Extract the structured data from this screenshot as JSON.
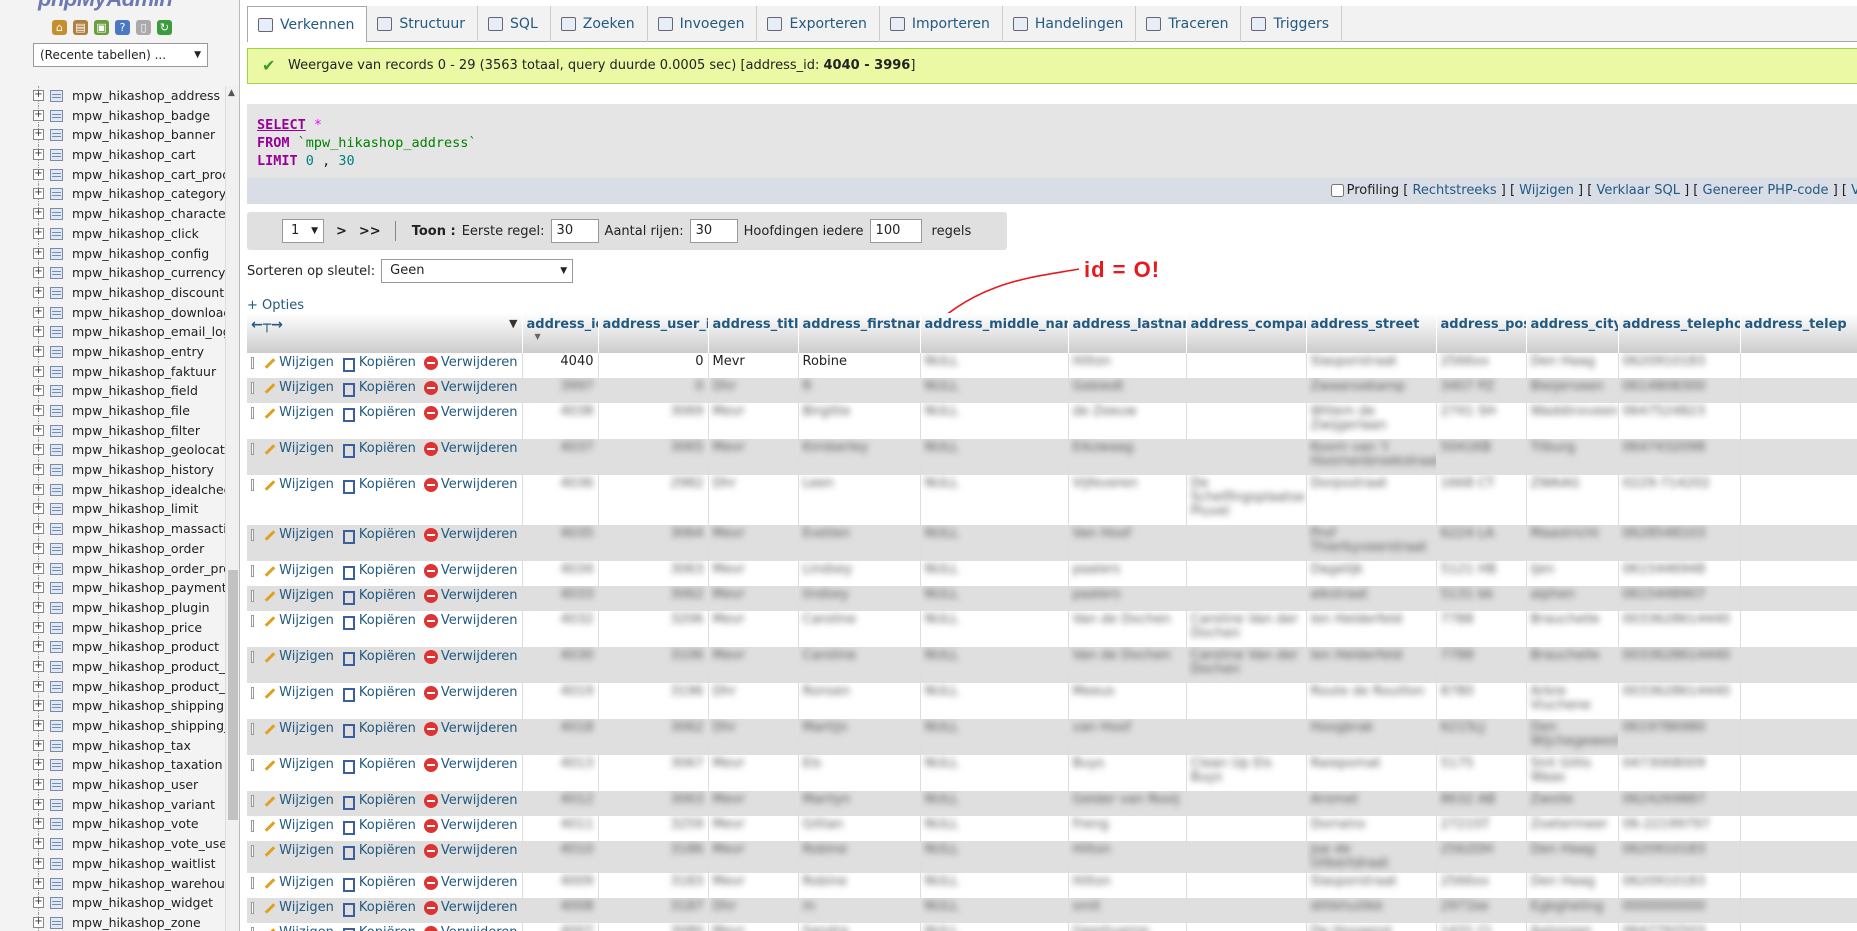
{
  "sidebar": {
    "logo": "phpMyAdmin",
    "recent_select": "(Recente tabellen) ...",
    "tables": [
      "mpw_hikashop_address",
      "mpw_hikashop_badge",
      "mpw_hikashop_banner",
      "mpw_hikashop_cart",
      "mpw_hikashop_cart_produ",
      "mpw_hikashop_category",
      "mpw_hikashop_characteri",
      "mpw_hikashop_click",
      "mpw_hikashop_config",
      "mpw_hikashop_currency",
      "mpw_hikashop_discount",
      "mpw_hikashop_download",
      "mpw_hikashop_email_log",
      "mpw_hikashop_entry",
      "mpw_hikashop_faktuur",
      "mpw_hikashop_field",
      "mpw_hikashop_file",
      "mpw_hikashop_filter",
      "mpw_hikashop_geolocatic",
      "mpw_hikashop_history",
      "mpw_hikashop_idealchecl",
      "mpw_hikashop_limit",
      "mpw_hikashop_massactic",
      "mpw_hikashop_order",
      "mpw_hikashop_order_proc",
      "mpw_hikashop_payment",
      "mpw_hikashop_plugin",
      "mpw_hikashop_price",
      "mpw_hikashop_product",
      "mpw_hikashop_product_c",
      "mpw_hikashop_product_re",
      "mpw_hikashop_shipping",
      "mpw_hikashop_shipping_p",
      "mpw_hikashop_tax",
      "mpw_hikashop_taxation",
      "mpw_hikashop_user",
      "mpw_hikashop_variant",
      "mpw_hikashop_vote",
      "mpw_hikashop_vote_user",
      "mpw_hikashop_waitlist",
      "mpw_hikashop_warehouse",
      "mpw_hikashop_widget",
      "mpw_hikashop_zone"
    ]
  },
  "tabs": [
    {
      "label": "Verkennen",
      "icon": "browse-icon"
    },
    {
      "label": "Structuur",
      "icon": "structure-icon"
    },
    {
      "label": "SQL",
      "icon": "sql-icon"
    },
    {
      "label": "Zoeken",
      "icon": "search-icon"
    },
    {
      "label": "Invoegen",
      "icon": "insert-icon"
    },
    {
      "label": "Exporteren",
      "icon": "export-icon"
    },
    {
      "label": "Importeren",
      "icon": "import-icon"
    },
    {
      "label": "Handelingen",
      "icon": "operations-icon"
    },
    {
      "label": "Traceren",
      "icon": "tracking-icon"
    },
    {
      "label": "Triggers",
      "icon": "triggers-icon"
    }
  ],
  "success": {
    "text": "Weergave van records 0 - 29 (3563 totaal, query duurde 0.0005 sec) [address_id: ",
    "range": "4040 - 3996",
    "close": "]"
  },
  "sql": {
    "select": "SELECT",
    "star": "*",
    "from": "FROM",
    "table": "`mpw_hikashop_address`",
    "limit": "LIMIT",
    "limit_val_a": "0",
    "limit_sep": ",",
    "limit_val_b": "30"
  },
  "sqlbar": {
    "profiling": "Profiling",
    "links": [
      "Rechtstreeks",
      "Wijzigen",
      "Verklaar SQL",
      "Genereer PHP-code",
      "Ve"
    ]
  },
  "nav": {
    "page": "1",
    "next": ">",
    "last": ">>",
    "toon": "Toon :",
    "eerste_label": "Eerste regel:",
    "eerste_val": "30",
    "aantal_label": "Aantal rijen:",
    "aantal_val": "30",
    "hoofd_label": "Hoofdingen iedere",
    "hoofd_val": "100",
    "regels": "regels"
  },
  "sort": {
    "label": "Sorteren op sleutel:",
    "value": "Geen"
  },
  "annotation": "id = O!",
  "opties": "+ Opties",
  "columns": [
    "address_id",
    "address_user_id",
    "address_title",
    "address_firstname",
    "address_middle_name",
    "address_lastname",
    "address_company",
    "address_street",
    "address_post_code",
    "address_city",
    "address_telephone",
    "address_telep"
  ],
  "actions": {
    "edit": "Wijzigen",
    "copy": "Kopiëren",
    "delete": "Verwijderen"
  },
  "first_row": {
    "address_id": "4040",
    "address_user_id": "0",
    "address_title": "Mevr",
    "address_firstname": "Robine"
  },
  "rows": [
    {
      "h": 25,
      "vals": [
        "4040",
        "0",
        "Mevr",
        "Robine",
        "NULL",
        "Hilton",
        "",
        "Slasporstraat",
        "2566xx",
        "Den Haag",
        "0620910183",
        ""
      ]
    },
    {
      "h": 25,
      "vals": [
        "3997",
        "0",
        "Dhr",
        "R",
        "NULL",
        "Gebiedt",
        "",
        "Zwaansekamp",
        "3407 PZ",
        "Bleijerveen",
        "0614808300",
        ""
      ]
    },
    {
      "h": 36,
      "vals": [
        "4038",
        "3069",
        "Mevr",
        "Birgitte",
        "NULL",
        "de Zeeuw",
        "",
        "Willem de Zwijgerlaan",
        "2741 SH",
        "Waddinxveen",
        "0647524823",
        ""
      ]
    },
    {
      "h": 36,
      "vals": [
        "4037",
        "3065",
        "Mevr",
        "Kimberley",
        "NULL",
        "Eikzwaag",
        "",
        "Koorn van 't Hoornenbroekstraat",
        "5041KB",
        "Tilburg",
        "0647432098",
        ""
      ]
    },
    {
      "h": 50,
      "vals": [
        "4036",
        "2982",
        "Dhr",
        "Leen",
        "NULL",
        "Vijfeveren",
        "De Schelfingsplaatse Pluvel",
        "Dorpsstraat",
        "1668 CT",
        "ZWAAG",
        "0229-714202",
        ""
      ]
    },
    {
      "h": 36,
      "vals": [
        "4035",
        "3064",
        "Mevr",
        "Evelien",
        "NULL",
        "Van Hoof",
        "",
        "Prof Thierbyveerstraat",
        "6224 LA",
        "Maastricht",
        "0628548103",
        ""
      ]
    },
    {
      "h": 25,
      "vals": [
        "4034",
        "3063",
        "Mevr",
        "Lindsey",
        "NULL",
        "paalers",
        "",
        "Dagelijk",
        "5121 HB",
        "Ijen",
        "0615446948",
        ""
      ]
    },
    {
      "h": 25,
      "vals": [
        "4033",
        "3062",
        "Mevr",
        "lindsey",
        "NULL",
        "paalers",
        "",
        "alkstraat",
        "5131 bk",
        "alphen",
        "0615448907",
        ""
      ]
    },
    {
      "h": 36,
      "vals": [
        "4032",
        "3206",
        "Mevr",
        "Caroline",
        "NULL",
        "Van de Dochen",
        "Caroline Van der Dochen",
        "Ien Helderfeld",
        "7788",
        "Brauchelle",
        "0033628614440",
        ""
      ]
    },
    {
      "h": 36,
      "vals": [
        "4030",
        "3106",
        "Mevr",
        "Caroline",
        "NULL",
        "Van de Dochen",
        "Caroline Van der Dochen",
        "Ien Helderfeld",
        "7788",
        "Brauchelle",
        "0033628614440",
        ""
      ]
    },
    {
      "h": 36,
      "vals": [
        "4019",
        "3196",
        "Dhr",
        "Ronsen",
        "NULL",
        "Meeus",
        "",
        "Route de Rouillon",
        "8780",
        "Arbre Viuchene",
        "0033628614440",
        ""
      ]
    },
    {
      "h": 36,
      "vals": [
        "4018",
        "3062",
        "Dhr",
        "Martijn",
        "NULL",
        "van Hoof",
        "",
        "Hoogbrak",
        "6215LJ",
        "Den Wijchegewest",
        "0619786980",
        ""
      ]
    },
    {
      "h": 36,
      "vals": [
        "4013",
        "3067",
        "Mevr",
        "Els",
        "NULL",
        "Buys",
        "Clean Up Els Buys",
        "Raiepomat",
        "5175",
        "Sint Gillis Waas",
        "0473068009",
        ""
      ]
    },
    {
      "h": 25,
      "vals": [
        "4012",
        "3063",
        "Mevr",
        "Marilyn",
        "NULL",
        "Gelder van Rooij",
        "",
        "Aromet",
        "8632 AB",
        "Zwolle",
        "0624269887",
        ""
      ]
    },
    {
      "h": 25,
      "vals": [
        "4011",
        "3259",
        "Mevr",
        "Gillian",
        "NULL",
        "Freng",
        "",
        "Dorrains",
        "2721ST",
        "Zoetermeer",
        "06-22199797",
        ""
      ]
    },
    {
      "h": 25,
      "vals": [
        "4010",
        "3186",
        "Mevr",
        "Robine",
        "NULL",
        "Hilton",
        "",
        "Joe de Uilbertdraat",
        "2562DH",
        "Den Haag",
        "0620910183",
        ""
      ]
    },
    {
      "h": 25,
      "vals": [
        "4009",
        "3183",
        "Mevr",
        "Robine",
        "NULL",
        "Hilton",
        "",
        "Slasporstraat",
        "2566xx",
        "Den Haag",
        "0620910183",
        ""
      ]
    },
    {
      "h": 25,
      "vals": [
        "4008",
        "3187",
        "Dhr",
        "m",
        "NULL",
        "smit",
        "",
        "dillikhuilikk",
        "2971ke",
        "Egbgheling",
        "0000000000",
        ""
      ]
    },
    {
      "h": 25,
      "vals": [
        "4007",
        "3080",
        "Mevr",
        "Sandra",
        "NULL",
        "Geerhueme",
        "",
        "De Hoogend",
        "1431 CJ",
        "Aalsmeer",
        "0647792503",
        ""
      ]
    }
  ]
}
